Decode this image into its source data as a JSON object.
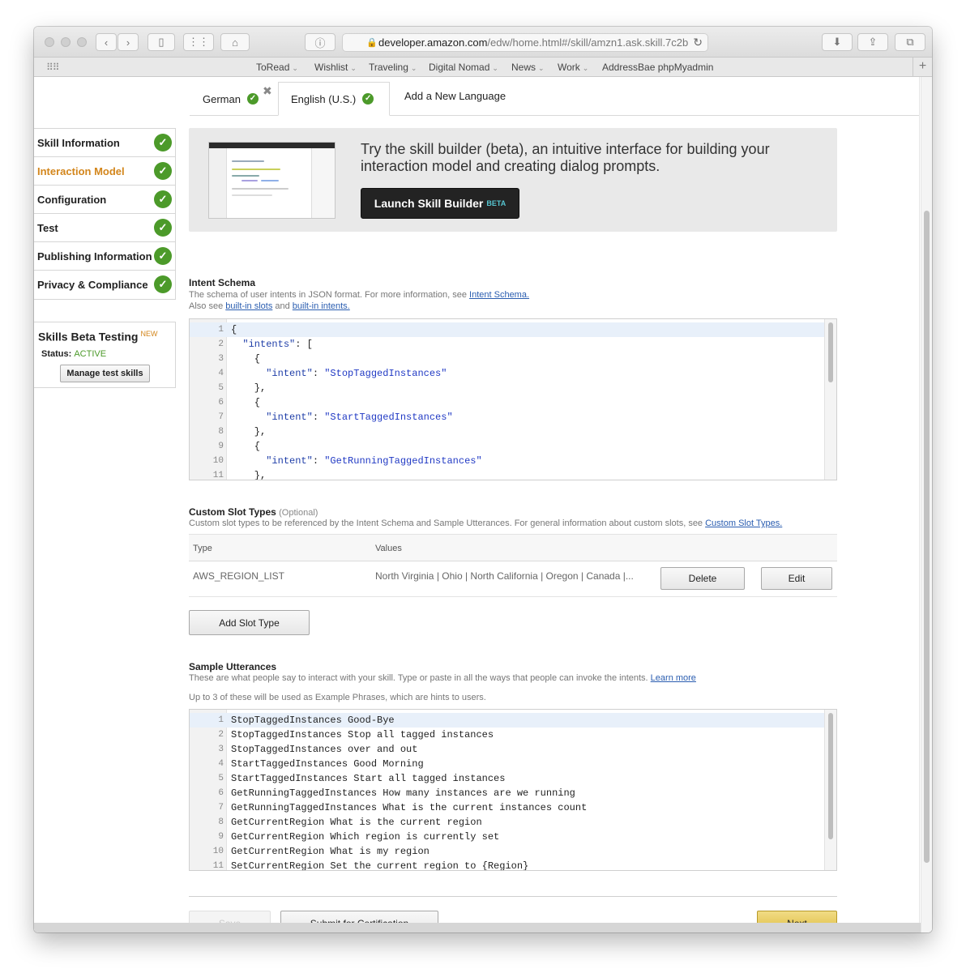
{
  "browser": {
    "url_host": "developer.amazon.com",
    "url_path": "/edw/home.html#/skill/amzn1.ask.skill.7c2b",
    "bookmarks": [
      {
        "label": "ToRead",
        "menu": true
      },
      {
        "label": "Wishlist",
        "menu": true
      },
      {
        "label": "Traveling",
        "menu": true
      },
      {
        "label": "Digital Nomad",
        "menu": true
      },
      {
        "label": "News",
        "menu": true
      },
      {
        "label": "Work",
        "menu": true
      },
      {
        "label": "AddressBae phpMyadmin",
        "menu": false
      }
    ]
  },
  "tabs": {
    "german": "German",
    "english": "English (U.S.)",
    "add_language": "Add a New Language",
    "close_glyph": "✖"
  },
  "sidebar": {
    "items": [
      {
        "label": "Skill Information",
        "active": false
      },
      {
        "label": "Interaction Model",
        "active": true
      },
      {
        "label": "Configuration",
        "active": false
      },
      {
        "label": "Test",
        "active": false
      },
      {
        "label": "Publishing Information",
        "active": false
      },
      {
        "label": "Privacy & Compliance",
        "active": false
      }
    ],
    "beta": {
      "title": "Skills Beta Testing",
      "badge": "NEW",
      "status_label": "Status:",
      "status_value": "ACTIVE",
      "manage_button": "Manage test skills"
    }
  },
  "promo": {
    "text": "Try the skill builder (beta), an intuitive interface for building your interaction model and creating dialog prompts.",
    "button": "Launch Skill Builder",
    "button_badge": "BETA"
  },
  "intent_schema": {
    "title": "Intent Schema",
    "desc_1": "The schema of user intents in JSON format. For more information, see ",
    "desc_1_link": "Intent Schema.",
    "desc_2_pre": "Also see ",
    "desc_2_link_1": "built-in slots",
    "desc_2_mid": " and ",
    "desc_2_link_2": "built-in intents.",
    "lines": [
      {
        "n": "1",
        "text": "{"
      },
      {
        "n": "2",
        "text": "  \"intents\": ["
      },
      {
        "n": "3",
        "text": "    {"
      },
      {
        "n": "4",
        "text": "      \"intent\": \"StopTaggedInstances\""
      },
      {
        "n": "5",
        "text": "    },"
      },
      {
        "n": "6",
        "text": "    {"
      },
      {
        "n": "7",
        "text": "      \"intent\": \"StartTaggedInstances\""
      },
      {
        "n": "8",
        "text": "    },"
      },
      {
        "n": "9",
        "text": "    {"
      },
      {
        "n": "10",
        "text": "      \"intent\": \"GetRunningTaggedInstances\""
      },
      {
        "n": "11",
        "text": "    },"
      }
    ]
  },
  "slot_types": {
    "title": "Custom Slot Types",
    "optional": "(Optional)",
    "desc": "Custom slot types to be referenced by the Intent Schema and Sample Utterances. For general information about custom slots, see ",
    "desc_link": "Custom Slot Types.",
    "col_type": "Type",
    "col_values": "Values",
    "rows": [
      {
        "type": "AWS_REGION_LIST",
        "values": "North Virginia | Ohio | North California | Oregon | Canada |..."
      }
    ],
    "delete": "Delete",
    "edit": "Edit",
    "add": "Add Slot Type"
  },
  "utterances": {
    "title": "Sample Utterances",
    "desc": "These are what people say to interact with your skill. Type or paste in all the ways that people can invoke the intents. ",
    "desc_link": "Learn more",
    "hint": "Up to 3 of these will be used as Example Phrases, which are hints to users.",
    "lines": [
      {
        "n": "1",
        "text": "StopTaggedInstances Good-Bye"
      },
      {
        "n": "2",
        "text": "StopTaggedInstances Stop all tagged instances"
      },
      {
        "n": "3",
        "text": "StopTaggedInstances over and out"
      },
      {
        "n": "4",
        "text": "StartTaggedInstances Good Morning"
      },
      {
        "n": "5",
        "text": "StartTaggedInstances Start all tagged instances"
      },
      {
        "n": "6",
        "text": "GetRunningTaggedInstances How many instances are we running"
      },
      {
        "n": "7",
        "text": "GetRunningTaggedInstances What is the current instances count"
      },
      {
        "n": "8",
        "text": "GetCurrentRegion What is the current region"
      },
      {
        "n": "9",
        "text": "GetCurrentRegion Which region is currently set"
      },
      {
        "n": "10",
        "text": "GetCurrentRegion What is my region"
      },
      {
        "n": "11",
        "text": "SetCurrentRegion Set the current region to {Region}"
      }
    ]
  },
  "footer": {
    "save": "Save",
    "submit": "Submit for Certification",
    "next": "Next"
  },
  "colors": {
    "active_nav": "#d3861c",
    "check_green": "#4c9a2a",
    "link": "#2a5db0",
    "next_button": "#dcb93a"
  }
}
